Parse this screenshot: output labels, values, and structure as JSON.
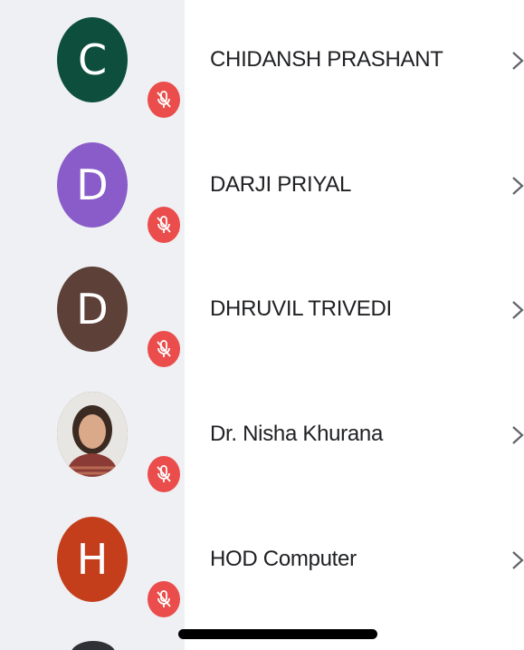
{
  "participants": [
    {
      "initial": "C",
      "name": "CHIDANSH PRASHANT",
      "avatar_color": "#0d4f3c",
      "muted": true
    },
    {
      "initial": "D",
      "name": "DARJI PRIYAL",
      "avatar_color": "#8a5cc9",
      "muted": true
    },
    {
      "initial": "D",
      "name": "DHRUVIL TRIVEDI",
      "avatar_color": "#5d4037",
      "muted": true
    },
    {
      "initial": "",
      "name": "Dr. Nisha Khurana",
      "avatar_color": "#7b5545",
      "muted": true,
      "photo": true
    },
    {
      "initial": "H",
      "name": "HOD Computer",
      "avatar_color": "#c43e1c",
      "muted": true
    }
  ],
  "icons": {
    "muted": "mic-off-icon",
    "chevron": "chevron-right-icon"
  },
  "colors": {
    "muted_badge": "#ea4d4b",
    "left_panel": "#eef0f3"
  }
}
